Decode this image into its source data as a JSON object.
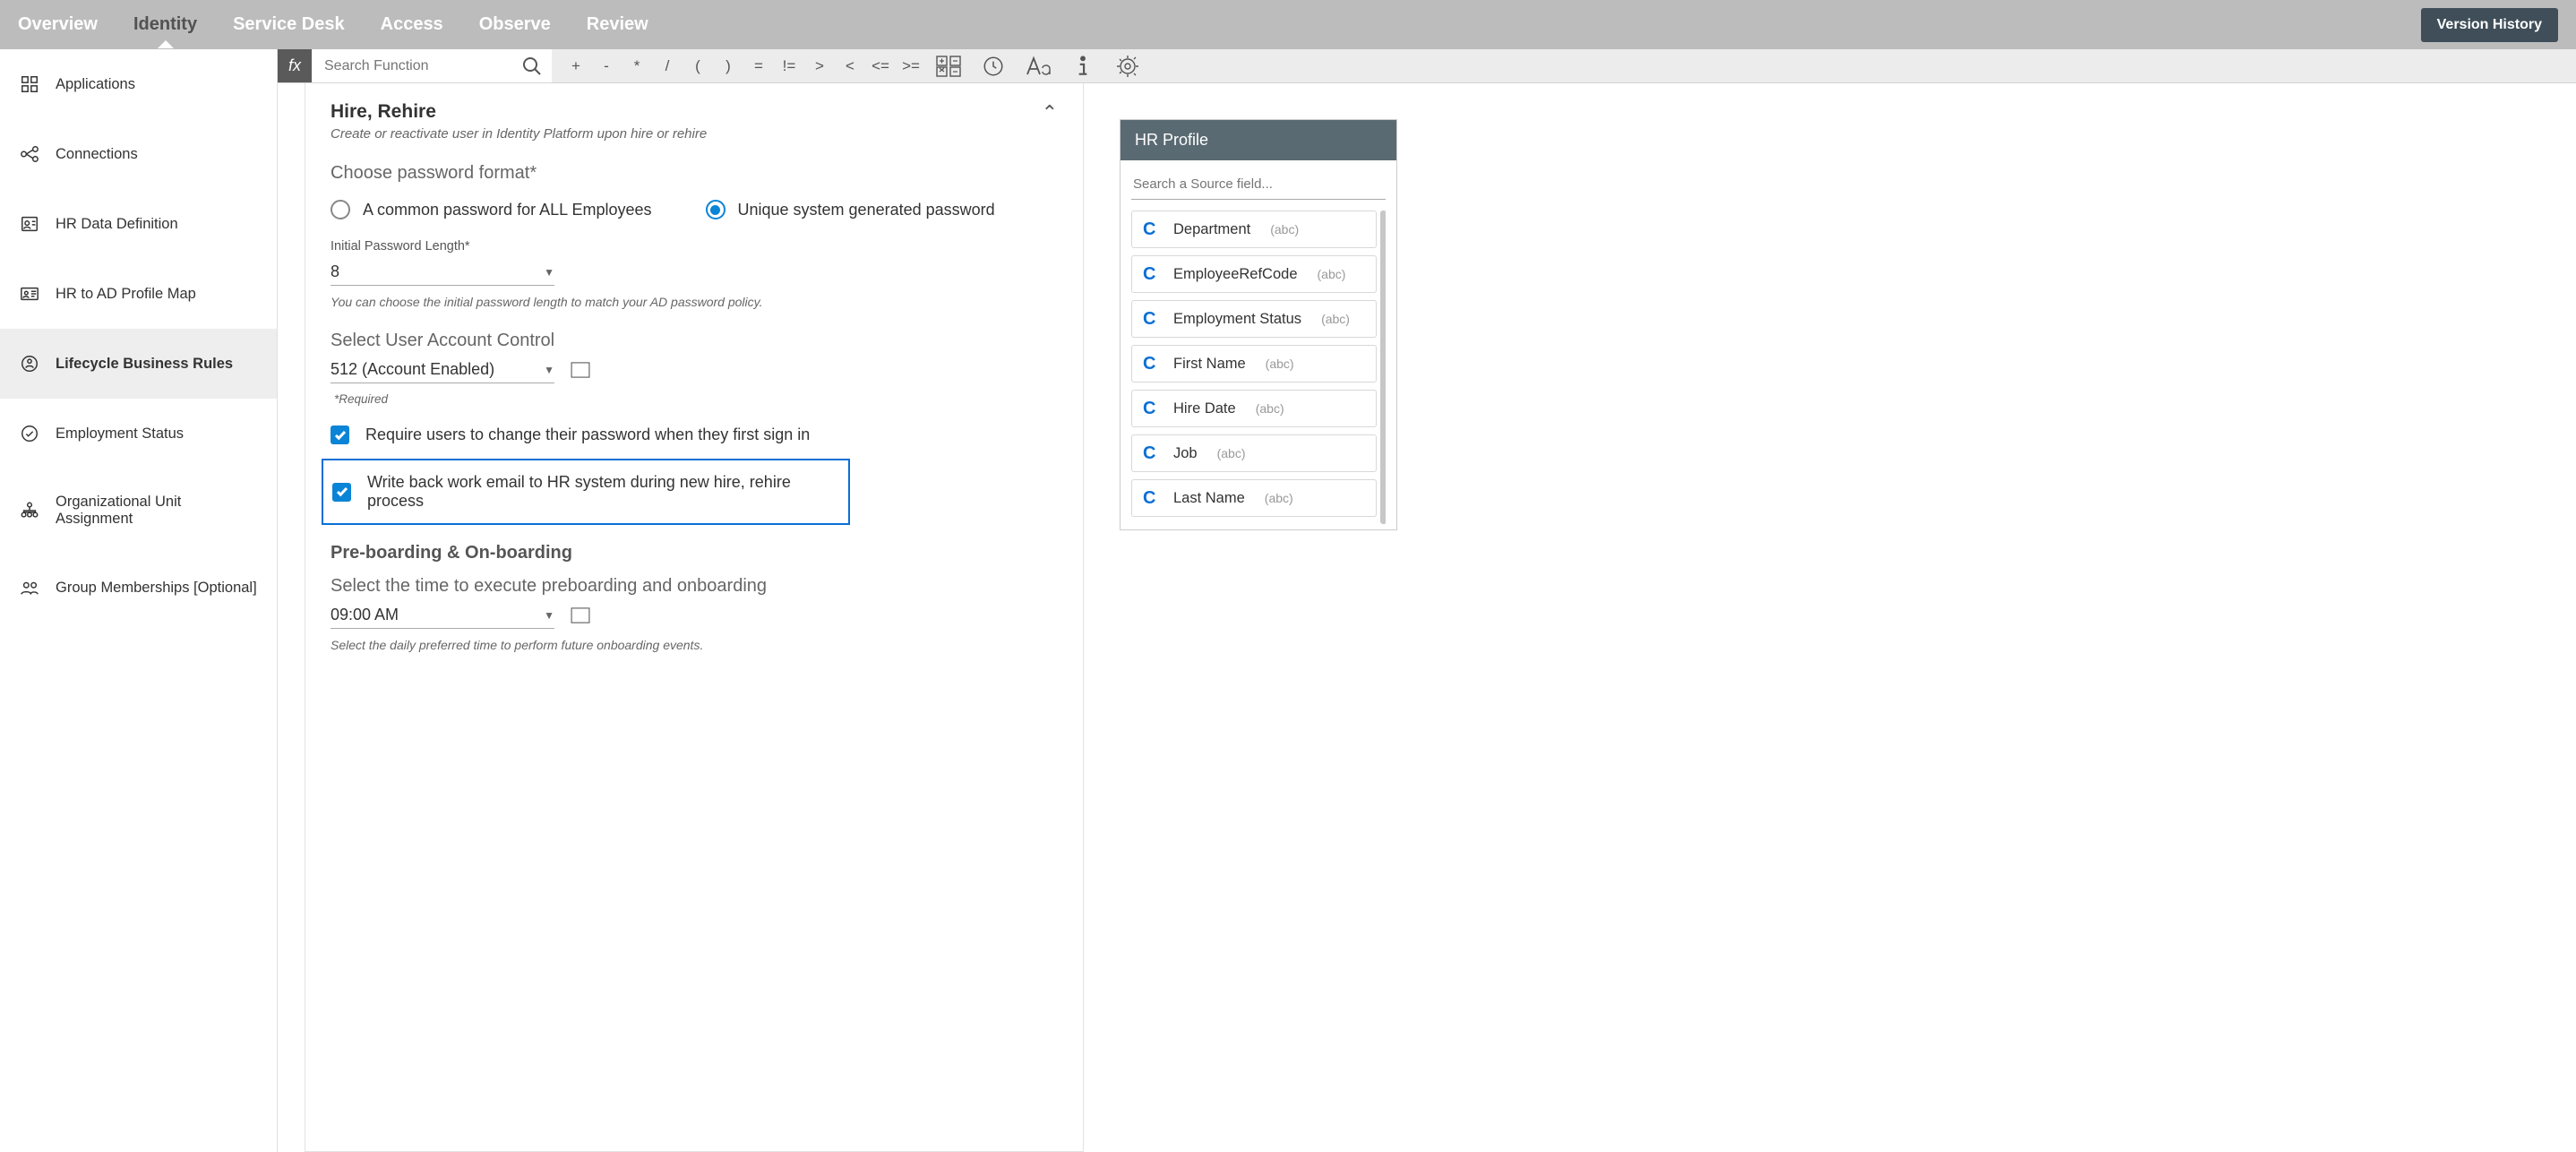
{
  "nav": {
    "tabs": [
      "Overview",
      "Identity",
      "Service Desk",
      "Access",
      "Observe",
      "Review"
    ],
    "active": "Identity",
    "version_btn": "Version History"
  },
  "sidebar": {
    "items": [
      {
        "label": "Applications",
        "icon": "apps"
      },
      {
        "label": "Connections",
        "icon": "connections"
      },
      {
        "label": "HR Data Definition",
        "icon": "hrdata"
      },
      {
        "label": "HR to AD Profile Map",
        "icon": "profilemap"
      },
      {
        "label": "Lifecycle Business Rules",
        "icon": "lifecycle"
      },
      {
        "label": "Employment Status",
        "icon": "status"
      },
      {
        "label": "Organizational Unit Assignment",
        "icon": "org"
      },
      {
        "label": "Group Memberships [Optional]",
        "icon": "groups"
      }
    ],
    "active_index": 4
  },
  "formula": {
    "fx": "fx",
    "search_placeholder": "Search Function",
    "ops": [
      "+",
      "-",
      "*",
      "/",
      "(",
      ")",
      "=",
      "!=",
      ">",
      "<",
      "<=",
      ">="
    ]
  },
  "form": {
    "header_title": "Hire, Rehire",
    "header_sub": "Create or reactivate user in Identity Platform upon hire or rehire",
    "pw_section": "Choose password format*",
    "pw_opt_common": "A common password for ALL Employees",
    "pw_opt_unique": "Unique system generated password",
    "pw_len_label": "Initial Password Length*",
    "pw_len_value": "8",
    "pw_len_help": "You can choose the initial password length to match your AD password policy.",
    "uac_label": "Select User Account Control",
    "uac_value": "512 (Account Enabled)",
    "uac_required": "*Required",
    "chk_require_change": "Require users to change their password when they first sign in",
    "chk_writeback": "Write back work email to HR system during new hire, rehire process",
    "boarding_heading": "Pre-boarding & On-boarding",
    "boarding_label": "Select the time to execute preboarding and onboarding",
    "boarding_value": "09:00 AM",
    "boarding_help": "Select the daily preferred time to perform future onboarding events."
  },
  "hr": {
    "title": "HR Profile",
    "search_placeholder": "Search a Source field...",
    "type_label": "(abc)",
    "fields": [
      {
        "name": "Department"
      },
      {
        "name": "EmployeeRefCode"
      },
      {
        "name": "Employment Status"
      },
      {
        "name": "First Name"
      },
      {
        "name": "Hire Date"
      },
      {
        "name": "Job"
      },
      {
        "name": "Last Name"
      }
    ]
  }
}
